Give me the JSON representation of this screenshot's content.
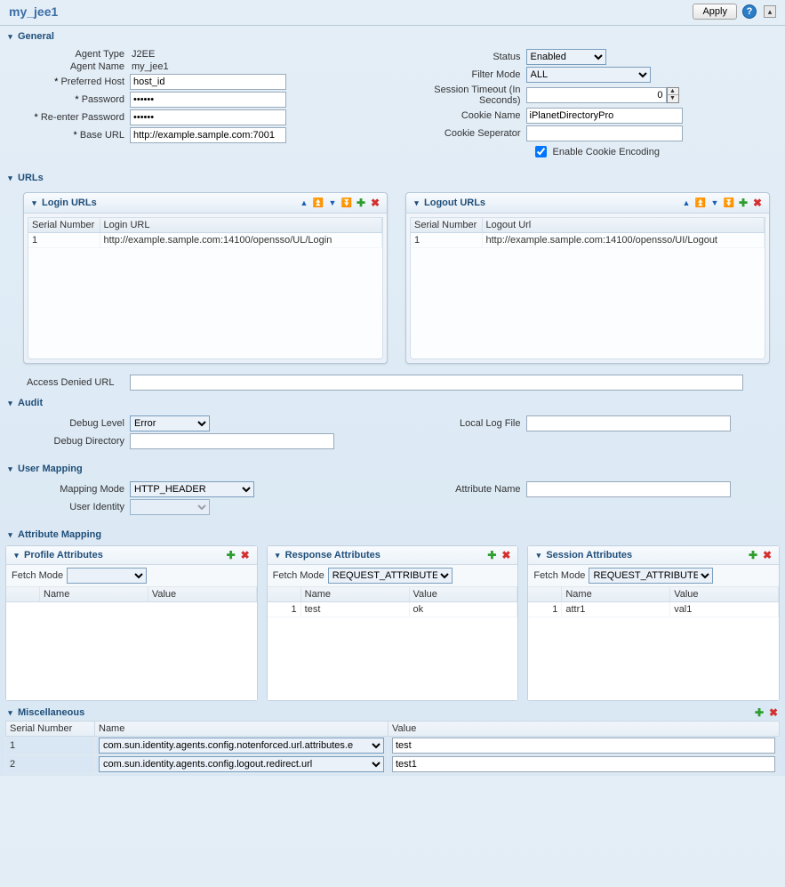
{
  "header": {
    "title": "my_jee1",
    "apply": "Apply"
  },
  "general": {
    "title": "General",
    "labels": {
      "agentType": "Agent Type",
      "agentName": "Agent Name",
      "preferredHost": "Preferred Host",
      "password": "Password",
      "rePassword": "Re-enter Password",
      "baseUrl": "Base URL",
      "status": "Status",
      "filterMode": "Filter Mode",
      "sessionTimeout": "Session Timeout (In Seconds)",
      "cookieName": "Cookie Name",
      "cookieSep": "Cookie Seperator",
      "enableCookieEnc": "Enable Cookie Encoding"
    },
    "values": {
      "agentType": "J2EE",
      "agentName": "my_jee1",
      "preferredHost": "host_id",
      "password": "••••••",
      "rePassword": "••••••",
      "baseUrl": "http://example.sample.com:7001",
      "status": "Enabled",
      "filterMode": "ALL",
      "sessionTimeout": "0",
      "cookieName": "iPlanetDirectoryPro",
      "cookieSep": "",
      "enableCookieEnc": true
    }
  },
  "urls": {
    "title": "URLs",
    "login": {
      "title": "Login URLs",
      "cols": {
        "sn": "Serial Number",
        "url": "Login URL"
      },
      "rows": [
        {
          "sn": "1",
          "url": "http://example.sample.com:14100/opensso/UL/Login"
        }
      ]
    },
    "logout": {
      "title": "Logout URLs",
      "cols": {
        "sn": "Serial Number",
        "url": "Logout Url"
      },
      "rows": [
        {
          "sn": "1",
          "url": "http://example.sample.com:14100/opensso/UI/Logout"
        }
      ]
    },
    "accessDenied": {
      "label": "Access Denied URL",
      "value": ""
    }
  },
  "audit": {
    "title": "Audit",
    "labels": {
      "debugLevel": "Debug Level",
      "debugDir": "Debug Directory",
      "localLog": "Local Log File"
    },
    "values": {
      "debugLevel": "Error",
      "debugDir": "",
      "localLog": ""
    }
  },
  "userMapping": {
    "title": "User Mapping",
    "labels": {
      "mode": "Mapping Mode",
      "identity": "User Identity",
      "attrName": "Attribute Name"
    },
    "values": {
      "mode": "HTTP_HEADER",
      "identity": "",
      "attrName": ""
    }
  },
  "attributeMapping": {
    "title": "Attribute Mapping",
    "fetchModeLabel": "Fetch Mode",
    "cols": {
      "name": "Name",
      "value": "Value"
    },
    "profile": {
      "title": "Profile Attributes",
      "fetchMode": "",
      "rows": []
    },
    "response": {
      "title": "Response Attributes",
      "fetchMode": "REQUEST_ATTRIBUTE",
      "rows": [
        {
          "idx": "1",
          "name": "test",
          "value": "ok"
        }
      ]
    },
    "session": {
      "title": "Session Attributes",
      "fetchMode": "REQUEST_ATTRIBUTE",
      "rows": [
        {
          "idx": "1",
          "name": "attr1",
          "value": "val1"
        }
      ]
    }
  },
  "misc": {
    "title": "Miscellaneous",
    "cols": {
      "sn": "Serial Number",
      "name": "Name",
      "value": "Value"
    },
    "rows": [
      {
        "sn": "1",
        "name": "com.sun.identity.agents.config.notenforced.url.attributes.e",
        "value": "test"
      },
      {
        "sn": "2",
        "name": "com.sun.identity.agents.config.logout.redirect.url",
        "value": "test1"
      }
    ]
  }
}
